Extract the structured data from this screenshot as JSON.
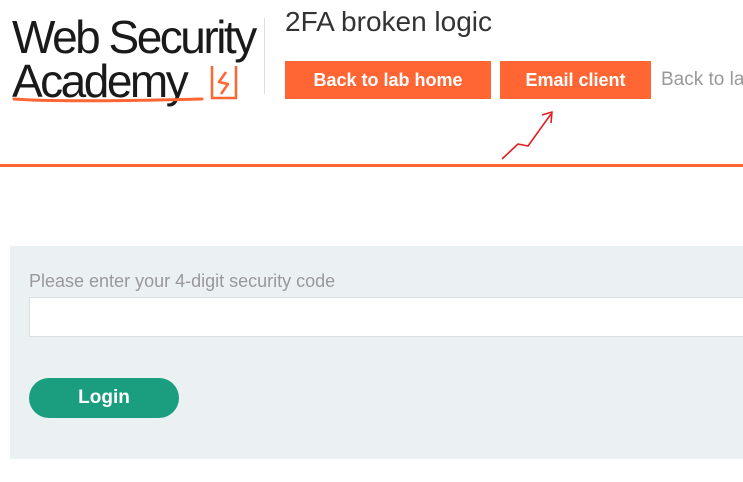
{
  "logo": {
    "line1": "Web Security",
    "line2": "Academy"
  },
  "header": {
    "lab_title": "2FA broken logic",
    "back_to_lab_home_label": "Back to lab home",
    "email_client_label": "Email client",
    "back_link_label": "Back to la"
  },
  "form": {
    "security_code_label": "Please enter your 4-digit security code",
    "security_code_value": "",
    "login_label": "Login"
  },
  "colors": {
    "brand_orange": "#ff6633",
    "login_green": "#1a9e7f",
    "panel_background": "#ebf0f2",
    "annotation_red": "#e02020"
  },
  "icons": {
    "logo_mark": "lightning-bolt-icon",
    "annotation": "annotation-arrow-icon"
  }
}
